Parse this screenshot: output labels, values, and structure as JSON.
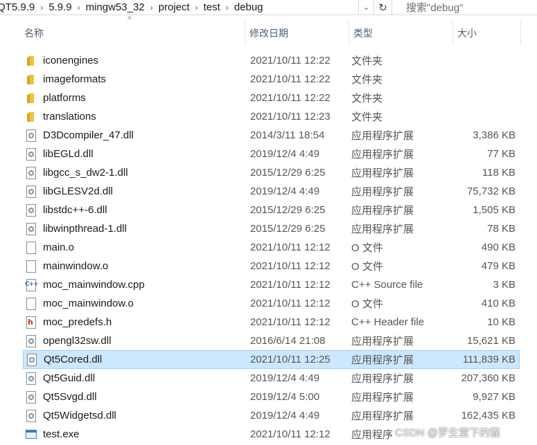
{
  "address": {
    "crumbs": [
      "QT5.9.9",
      "5.9.9",
      "mingw53_32",
      "project",
      "test",
      "debug"
    ],
    "separator": "›",
    "search_placeholder": "搜索\"debug\""
  },
  "header": {
    "name": "名称",
    "date": "修改日期",
    "type": "类型",
    "size": "大小"
  },
  "files": [
    {
      "name": "iconengines",
      "date": "2021/10/11 12:22",
      "type": "文件夹",
      "size": "",
      "icon": "folder-icon"
    },
    {
      "name": "imageformats",
      "date": "2021/10/11 12:22",
      "type": "文件夹",
      "size": "",
      "icon": "folder-icon"
    },
    {
      "name": "platforms",
      "date": "2021/10/11 12:22",
      "type": "文件夹",
      "size": "",
      "icon": "folder-icon"
    },
    {
      "name": "translations",
      "date": "2021/10/11 12:23",
      "type": "文件夹",
      "size": "",
      "icon": "folder-icon"
    },
    {
      "name": "D3Dcompiler_47.dll",
      "date": "2014/3/11 18:54",
      "type": "应用程序扩展",
      "size": "3,386 KB",
      "icon": "dll-icon"
    },
    {
      "name": "libEGLd.dll",
      "date": "2019/12/4 4:49",
      "type": "应用程序扩展",
      "size": "77 KB",
      "icon": "dll-icon"
    },
    {
      "name": "libgcc_s_dw2-1.dll",
      "date": "2015/12/29 6:25",
      "type": "应用程序扩展",
      "size": "118 KB",
      "icon": "dll-icon"
    },
    {
      "name": "libGLESV2d.dll",
      "date": "2019/12/4 4:49",
      "type": "应用程序扩展",
      "size": "75,732 KB",
      "icon": "dll-icon"
    },
    {
      "name": "libstdc++-6.dll",
      "date": "2015/12/29 6:25",
      "type": "应用程序扩展",
      "size": "1,505 KB",
      "icon": "dll-icon"
    },
    {
      "name": "libwinpthread-1.dll",
      "date": "2015/12/29 6:25",
      "type": "应用程序扩展",
      "size": "78 KB",
      "icon": "dll-icon"
    },
    {
      "name": "main.o",
      "date": "2021/10/11 12:12",
      "type": "O 文件",
      "size": "490 KB",
      "icon": "file-icon"
    },
    {
      "name": "mainwindow.o",
      "date": "2021/10/11 12:12",
      "type": "O 文件",
      "size": "479 KB",
      "icon": "file-icon"
    },
    {
      "name": "moc_mainwindow.cpp",
      "date": "2021/10/11 12:12",
      "type": "C++ Source file",
      "size": "3 KB",
      "icon": "cpp-icon"
    },
    {
      "name": "moc_mainwindow.o",
      "date": "2021/10/11 12:12",
      "type": "O 文件",
      "size": "410 KB",
      "icon": "file-icon"
    },
    {
      "name": "moc_predefs.h",
      "date": "2021/10/11 12:12",
      "type": "C++ Header file",
      "size": "10 KB",
      "icon": "header-icon"
    },
    {
      "name": "opengl32sw.dll",
      "date": "2016/6/14 21:08",
      "type": "应用程序扩展",
      "size": "15,621 KB",
      "icon": "dll-icon"
    },
    {
      "name": "Qt5Cored.dll",
      "date": "2021/10/11 12:25",
      "type": "应用程序扩展",
      "size": "111,839 KB",
      "icon": "dll-icon",
      "selected": true
    },
    {
      "name": "Qt5Guid.dll",
      "date": "2019/12/4 4:49",
      "type": "应用程序扩展",
      "size": "207,360 KB",
      "icon": "dll-icon"
    },
    {
      "name": "Qt5Svgd.dll",
      "date": "2019/12/4 5:00",
      "type": "应用程序扩展",
      "size": "9,927 KB",
      "icon": "dll-icon"
    },
    {
      "name": "Qt5Widgetsd.dll",
      "date": "2019/12/4 4:49",
      "type": "应用程序扩展",
      "size": "162,435 KB",
      "icon": "dll-icon"
    },
    {
      "name": "test.exe",
      "date": "2021/10/11 12:12",
      "type": "应用程序",
      "size": "",
      "icon": "exe-icon"
    }
  ],
  "watermark": "CSDN @罗生堂下的猫",
  "colors": {
    "selection_bg": "#cce8ff",
    "selection_border": "#99d1ff",
    "header_text": "#4c607a"
  }
}
